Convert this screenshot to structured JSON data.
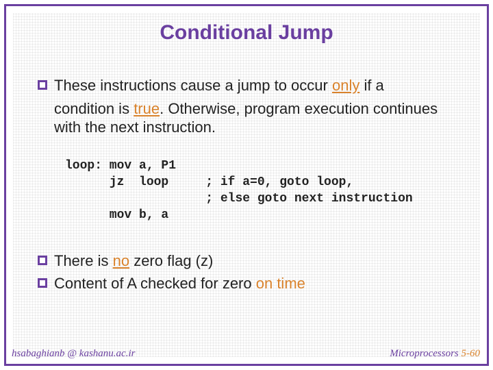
{
  "title": "Conditional Jump",
  "bullet1_a": "These instructions cause a jump to occur ",
  "bullet1_only": "only",
  "bullet1_b": " if a",
  "bullet1_cont_a": "condition is ",
  "bullet1_true": "true",
  "bullet1_cont_b": ". Otherwise, program execution continues with the next instruction.",
  "code_line1": "loop: mov a, P1",
  "code_line2": "      jz  loop     ; if a=0, goto loop,",
  "code_line3": "                   ; else goto next instruction",
  "code_line4": "      mov b, a",
  "bullet2_a": "There is ",
  "bullet2_no": "no",
  "bullet2_b": " zero flag (z)",
  "bullet3_a": "Content of A checked for zero ",
  "bullet3_ontime": "on time",
  "footer_left": "hsabaghianb @ kashanu.ac.ir",
  "footer_right_a": "Microprocessors ",
  "footer_right_b": "5-60"
}
